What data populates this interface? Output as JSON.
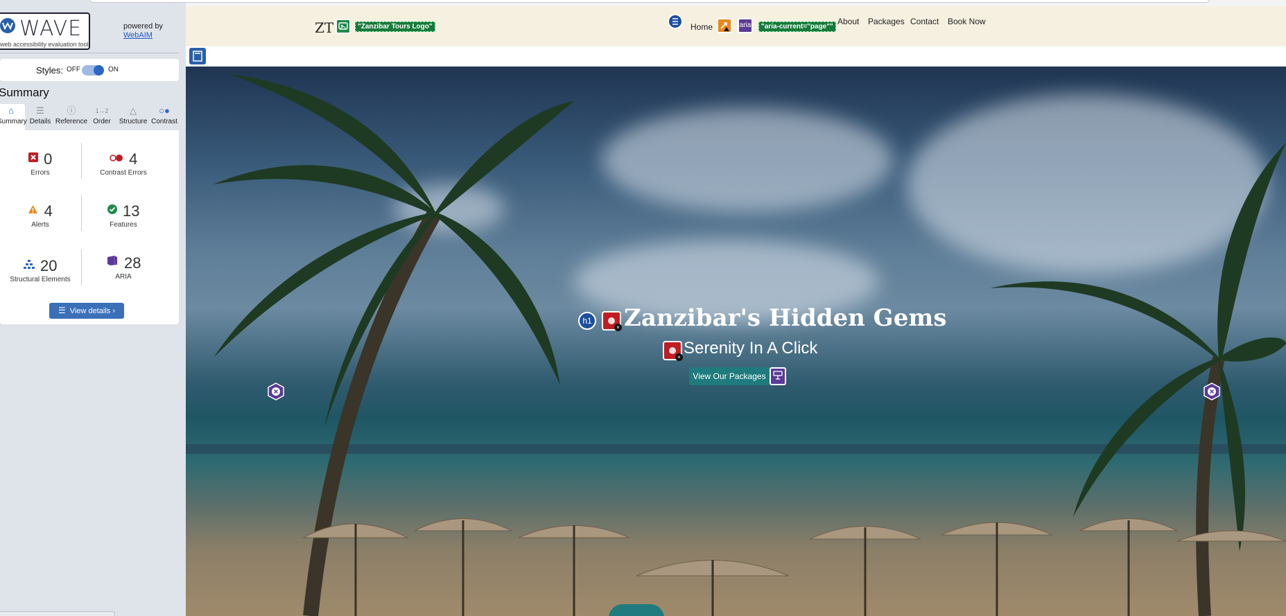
{
  "wave": {
    "logo_word": "WAVE",
    "tagline": "web accessibility evaluation tool",
    "powered_by": "powered by",
    "webaim": "WebAIM",
    "styles_label": "Styles:",
    "styles_off": "OFF",
    "styles_on": "ON",
    "summary_title": "Summary",
    "tabs": [
      {
        "label": "Summary",
        "icon": "home-icon"
      },
      {
        "label": "Details",
        "icon": "list-icon"
      },
      {
        "label": "Reference",
        "icon": "info-icon"
      },
      {
        "label": "Order",
        "icon": "order-icon"
      },
      {
        "label": "Structure",
        "icon": "structure-icon"
      },
      {
        "label": "Contrast",
        "icon": "contrast-icon"
      }
    ],
    "stats": {
      "errors": {
        "value": "0",
        "label": "Errors"
      },
      "contrast_errors": {
        "value": "4",
        "label": "Contrast Errors"
      },
      "alerts": {
        "value": "4",
        "label": "Alerts"
      },
      "features": {
        "value": "13",
        "label": "Features"
      },
      "structural": {
        "value": "20",
        "label": "Structural Elements"
      },
      "aria": {
        "value": "28",
        "label": "ARIA"
      }
    },
    "view_details": "View details ›",
    "colors": {
      "accent": "#2c66c4",
      "error": "#c01d23",
      "alert": "#e8891a",
      "feature": "#1f8a4c",
      "aria": "#5b3a96"
    }
  },
  "site": {
    "logo_text": "ZT",
    "logo_alt": "\"Zanzibar Tours Logo\"",
    "nav": {
      "home": "Home",
      "aria_label": "aria",
      "aria_current": "\"aria-current=\"page\"\"",
      "about": "About",
      "packages": "Packages",
      "contact": "Contact",
      "book_now": "Book Now"
    },
    "hero": {
      "h1_badge": "h1",
      "title": "Zanzibar's Hidden Gems",
      "subtitle": "Serenity In A Click",
      "button": "View Our Packages"
    }
  }
}
